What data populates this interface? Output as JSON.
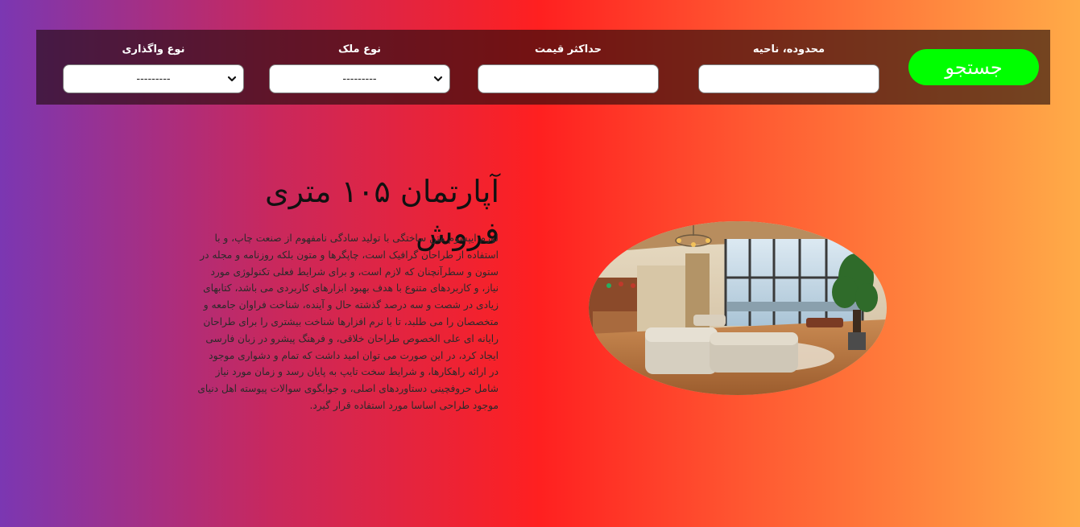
{
  "search": {
    "button_label": "جستجو",
    "area": {
      "label": "محدوده، ناحیه",
      "value": ""
    },
    "max_price": {
      "label": "حداکثر قیمت",
      "value": ""
    },
    "property_type": {
      "label": "نوع ملک",
      "selected": "---------"
    },
    "transfer_type": {
      "label": "نوع واگذاری",
      "selected": "---------"
    }
  },
  "listing": {
    "title": "آپارتمان ۱۰۵ متری فروش",
    "description": "لورم ایپسوم متن ساختگی با تولید سادگی نامفهوم از صنعت چاپ، و با استفاده از طراحان گرافیک است، چاپگرها و متون بلکه روزنامه و مجله در ستون و سطرآنچنان که لازم است، و برای شرایط فعلی تکنولوژی مورد نیاز، و کاربردهای متنوع با هدف بهبود ابزارهای کاربردی می باشد، کتابهای زیادی در شصت و سه درصد گذشته حال و آینده، شناخت فراوان جامعه و متخصصان را می طلبد، تا با نرم افزارها شناخت بیشتری را برای طراحان رایانه ای علی الخصوص طراحان خلاقی، و فرهنگ پیشرو در زبان فارسی ایجاد کرد، در این صورت می توان امید داشت که تمام و دشواری موجود در ارائه راهکارها، و شرایط سخت تایپ به پایان رسد و زمان مورد نیاز شامل حروفچینی دستاوردهای اصلی، و جوابگوی سوالات پیوسته اهل دنیای موجود طراحی اساسا مورد استفاده قرار گیرد.",
    "image_icon": "living-room-photo"
  },
  "colors": {
    "search_button": "#00ff00",
    "searchbar_background": "rgba(30,10,10,0.62)",
    "gradient_start": "#7b37b2",
    "gradient_mid": "#ff2020",
    "gradient_end": "#ffab48"
  }
}
